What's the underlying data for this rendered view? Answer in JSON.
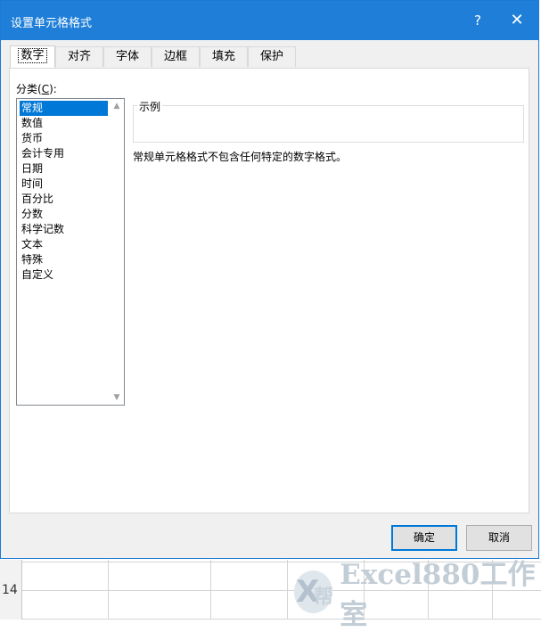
{
  "dialog": {
    "title": "设置单元格格式",
    "help_label": "?",
    "close_label": "✕"
  },
  "tabs": [
    "数字",
    "对齐",
    "字体",
    "边框",
    "填充",
    "保护"
  ],
  "active_tab": "数字",
  "category": {
    "label_prefix": "分类(",
    "label_accel": "C",
    "label_suffix": "):",
    "items": [
      "常规",
      "数值",
      "货币",
      "会计专用",
      "日期",
      "时间",
      "百分比",
      "分数",
      "科学记数",
      "文本",
      "特殊",
      "自定义"
    ],
    "selected": "常规"
  },
  "sample": {
    "label": "示例",
    "value": ""
  },
  "description": "常规单元格格式不包含任何特定的数字格式。",
  "buttons": {
    "ok": "确定",
    "cancel": "取消"
  },
  "sheet": {
    "row_number": "14"
  },
  "watermark": {
    "logo_letter": "X",
    "logo_char": "帮",
    "text": "Excel880工作室"
  },
  "colors": {
    "titlebar": "#1f7fd8",
    "selection": "#0078d7",
    "dialog_bg": "#f0f0f0"
  }
}
